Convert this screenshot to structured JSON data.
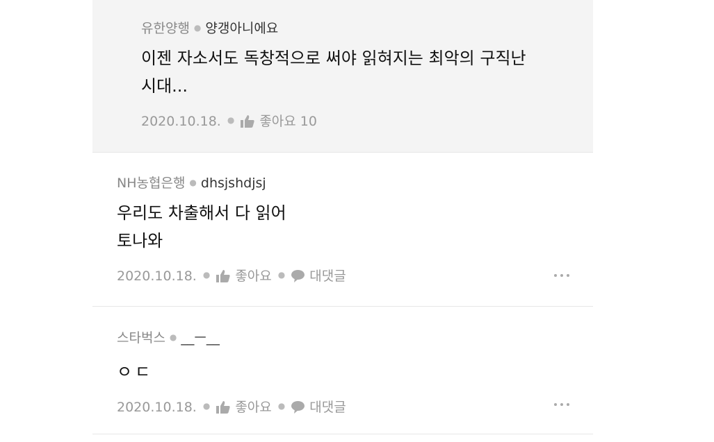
{
  "comments": [
    {
      "company": "유한양행",
      "nickname": "양갱아니에요",
      "text": "이젠 자소서도 독창적으로 써야 읽혀지는 최악의 구직난\n시대...",
      "date": "2020.10.18.",
      "like_label": "좋아요 10"
    },
    {
      "company": "NH농협은행",
      "nickname": "dhsjshdjsj",
      "text": "우리도 차출해서 다 읽어\n토나와",
      "date": "2020.10.18.",
      "like_label": "좋아요",
      "reply_label": "대댓글"
    },
    {
      "company": "스타벅스",
      "nickname": "__ㅡ__",
      "text": "ㅇㄷ",
      "date": "2020.10.18.",
      "like_label": "좋아요",
      "reply_label": "대댓글"
    }
  ],
  "colors": {
    "reply_background": "#f4f4f4",
    "icon": "#aaaaaa",
    "divider": "#e6e6e6"
  },
  "icons": {
    "like": "thumbs-up-icon",
    "reply": "speech-bubble-icon",
    "more": "more-dots-icon"
  }
}
